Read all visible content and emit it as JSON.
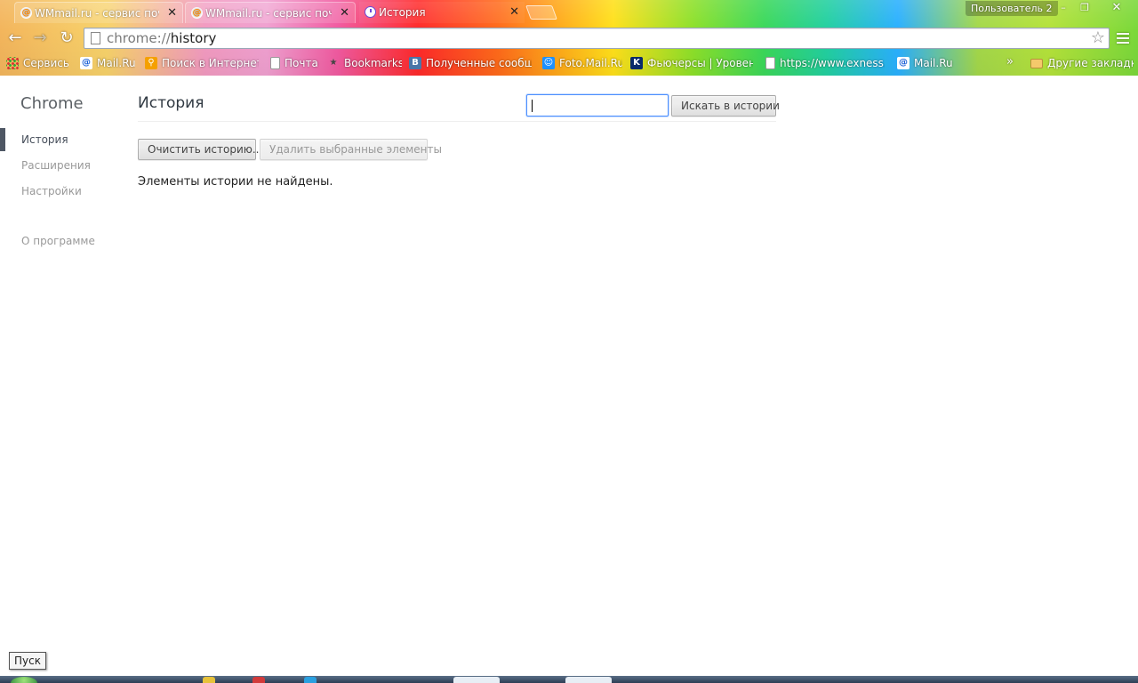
{
  "window": {
    "profile_label": "Пользователь 2",
    "minimize_glyph": "–",
    "maximize_glyph": "❐",
    "close_glyph": "✕"
  },
  "tabs": [
    {
      "title": "WMmail.ru - сервис почт",
      "icon": "mail-icon",
      "active": false
    },
    {
      "title": "WMmail.ru - сервис почт",
      "icon": "mail-icon",
      "active": false
    },
    {
      "title": "История",
      "icon": "history-icon",
      "active": true
    }
  ],
  "tab_close_glyph": "✕",
  "toolbar": {
    "back_glyph": "←",
    "forward_glyph": "→",
    "reload_glyph": "↻",
    "url_scheme": "chrome://",
    "url_path": "history",
    "star_glyph": "☆"
  },
  "bookmarks": [
    {
      "label": "Сервисы",
      "icon": "apps-icon"
    },
    {
      "label": "Mail.Ru",
      "icon": "mail-ru-icon"
    },
    {
      "label": "Поиск в Интернете",
      "icon": "search-icon"
    },
    {
      "label": "Почта",
      "icon": "page-icon"
    },
    {
      "label": "Bookmarks",
      "icon": "star-icon"
    },
    {
      "label": "Полученные сообще",
      "icon": "vk-icon"
    },
    {
      "label": "Foto.Mail.Ru",
      "icon": "foto-icon"
    },
    {
      "label": "Фьючерсы | Уровень",
      "icon": "k-icon"
    },
    {
      "label": "https://www.exness.c",
      "icon": "page-icon"
    },
    {
      "label": "Mail.Ru",
      "icon": "mail-ru-icon"
    }
  ],
  "bookmarks_more_glyph": "»",
  "other_bookmarks_label": "Другие закладки",
  "sidebar": {
    "brand": "Chrome",
    "items": [
      {
        "label": "История",
        "selected": true
      },
      {
        "label": "Расширения",
        "selected": false
      },
      {
        "label": "Настройки",
        "selected": false
      }
    ],
    "about": "О программе"
  },
  "history": {
    "title": "История",
    "search_value": "",
    "search_button": "Искать в истории",
    "clear_button": "Очистить историю...",
    "remove_button": "Удалить выбранные элементы",
    "empty_message": "Элементы истории не найдены."
  },
  "taskbar": {
    "start_label": "Пуск"
  },
  "colors": {
    "accent_focus": "#4d90fe",
    "sidebar_selected": "#4e5764",
    "title_text": "#303942"
  }
}
